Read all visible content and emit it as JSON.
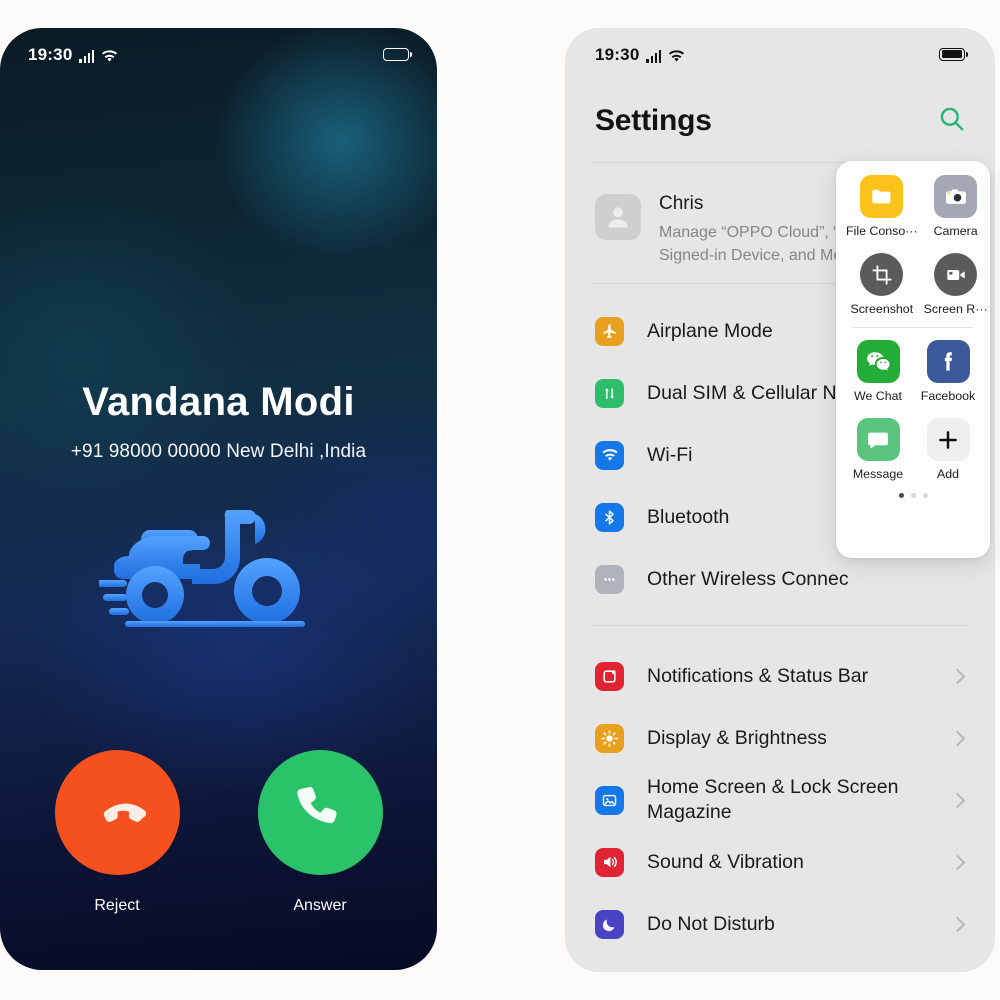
{
  "background_color": "#FCFBF9",
  "call_screen": {
    "status_bar": {
      "time": "19:30",
      "signal_icon": "cellular-signal-icon",
      "wifi_icon": "wifi-icon",
      "battery_icon": "battery-icon"
    },
    "caller_name": "Vandana Modi",
    "caller_details": "+91 98000 00000 New Delhi ,India",
    "illustration": "scooter-icon",
    "illustration_color": "#2e86f0",
    "reject": {
      "label": "Reject",
      "icon": "phone-hangup-icon",
      "color": "#F4511E"
    },
    "answer": {
      "label": "Answer",
      "icon": "phone-call-icon",
      "color": "#2BC36A"
    }
  },
  "settings_screen": {
    "status_bar": {
      "time": "19:30",
      "signal_icon": "cellular-signal-icon",
      "wifi_icon": "wifi-icon",
      "battery_icon": "battery-icon"
    },
    "title": "Settings",
    "search_icon": "search-icon",
    "search_icon_color": "#22B573",
    "account": {
      "avatar_icon": "person-avatar-icon",
      "name": "Chris",
      "description": "Manage “OPPO Cloud”, “Fin\nSigned-in Device, and More"
    },
    "group_one": [
      {
        "label": "Airplane Mode",
        "icon": "airplane-icon",
        "color": "#E8A11E"
      },
      {
        "label": "Dual SIM  & Cellular Ne",
        "icon": "dual-sim-icon",
        "color": "#2EBD6B"
      },
      {
        "label": "Wi-Fi",
        "icon": "wifi-icon",
        "color": "#1677E8"
      },
      {
        "label": "Bluetooth",
        "icon": "bluetooth-icon",
        "color": "#1677E8"
      },
      {
        "label": "Other Wireless Connec",
        "icon": "ellipsis-icon",
        "color": "#AFB3BA"
      }
    ],
    "group_two": [
      {
        "label": "Notifications & Status Bar",
        "icon": "notification-bell-icon",
        "color": "#E02433"
      },
      {
        "label": "Display & Brightness",
        "icon": "brightness-icon",
        "color": "#E8A11E"
      },
      {
        "label": "Home Screen & Lock Screen Magazine",
        "icon": "home-screen-icon",
        "color": "#1677E8"
      },
      {
        "label": "Sound & Vibration",
        "icon": "speaker-icon",
        "color": "#E02433"
      },
      {
        "label": "Do Not Disturb",
        "icon": "moon-icon",
        "color": "#4A43C4"
      }
    ]
  },
  "share_popup": {
    "items": [
      {
        "label": "File Conso···",
        "icon": "folder-icon",
        "color": "#FBC21B",
        "shape": "rounded"
      },
      {
        "label": "Camera",
        "icon": "camera-icon",
        "color": "#A3A8B4",
        "shape": "rounded"
      },
      {
        "label": "Screenshot",
        "icon": "crop-screenshot-icon",
        "color": "#5B5B5B",
        "shape": "round"
      },
      {
        "label": "Screen R···",
        "icon": "screen-record-icon",
        "color": "#5B5B5B",
        "shape": "round"
      },
      {
        "label": "We Chat",
        "icon": "wechat-icon",
        "color": "#23AC38",
        "shape": "rounded"
      },
      {
        "label": "Facebook",
        "icon": "facebook-icon",
        "color": "#3B5998",
        "shape": "rounded"
      },
      {
        "label": "Message",
        "icon": "message-bubble-icon",
        "color": "#5BC47E",
        "shape": "rounded"
      },
      {
        "label": "Add",
        "icon": "plus-add-icon",
        "color": "#EFEFEF",
        "shape": "rounded"
      }
    ],
    "page_dots": {
      "count": 3,
      "active": 0
    }
  }
}
